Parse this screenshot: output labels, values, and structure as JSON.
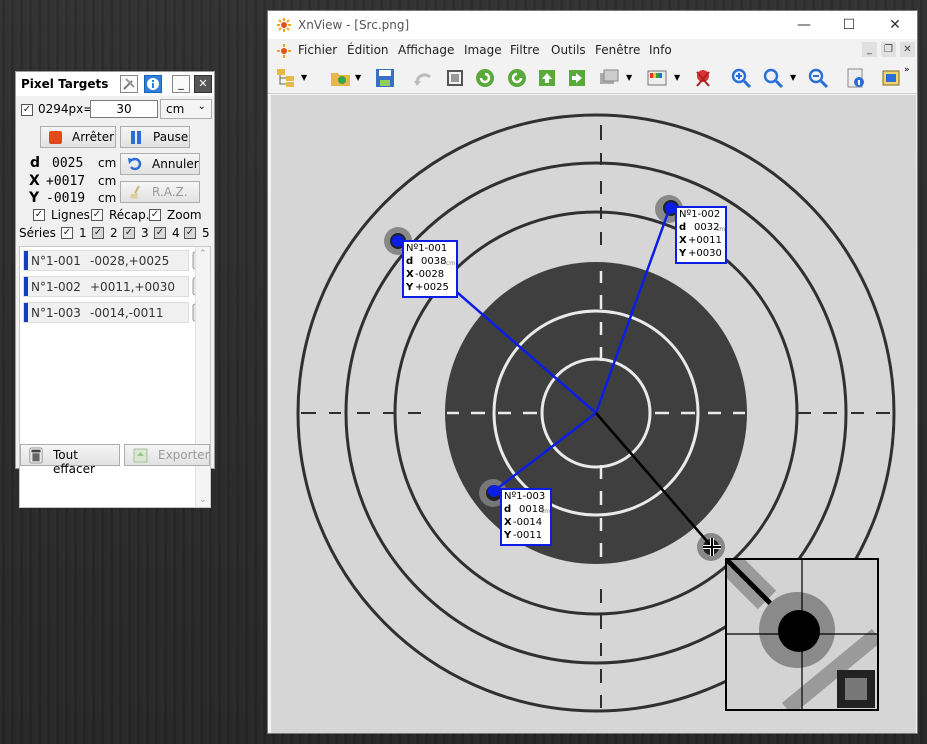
{
  "pixel_targets": {
    "title": "Pixel Targets",
    "calib_label": "0294px=",
    "calib_value": "30",
    "unit": "cm",
    "buttons": {
      "stop": "Arrêter",
      "pause": "Pause",
      "undo": "Annuler",
      "reset": "R.A.Z.",
      "clear_all": "Tout effacer",
      "export": "Exporter"
    },
    "readout": {
      "d_label": "d",
      "d_value": "0025",
      "x_label": "X",
      "x_value": "+0017",
      "y_label": "Y",
      "y_value": "-0019",
      "unit": "cm"
    },
    "options": {
      "lines": "Lignes",
      "recap": "Récap.",
      "zoom": "Zoom"
    },
    "series_label": "Séries :",
    "series": [
      "1",
      "2",
      "3",
      "4",
      "5"
    ],
    "shots": [
      {
        "label": "N°1-001",
        "coords": "-0028,+0025"
      },
      {
        "label": "N°1-002",
        "coords": "+0011,+0030"
      },
      {
        "label": "N°1-003",
        "coords": "-0014,-0011"
      }
    ]
  },
  "xnview": {
    "title": "XnView - [Src.png]",
    "menu": [
      "Fichier",
      "Édition",
      "Affichage",
      "Image",
      "Filtre",
      "Outils",
      "Fenêtre",
      "Info"
    ],
    "annotations": [
      {
        "no": "Nº1-001",
        "d": "0038",
        "x": "-0028",
        "y": "+0025",
        "unit": "cm"
      },
      {
        "no": "Nº1-002",
        "d": "0032",
        "x": "+0011",
        "y": "+0030",
        "unit": "cm"
      },
      {
        "no": "Nº1-003",
        "d": "0018",
        "x": "-0014",
        "y": "-0011",
        "unit": "cm"
      }
    ]
  },
  "colors": {
    "accent": "#0a1ee6",
    "line": "#1a2fd0",
    "target_black": "#3d3d3d",
    "paper": "#d6d6d6"
  }
}
